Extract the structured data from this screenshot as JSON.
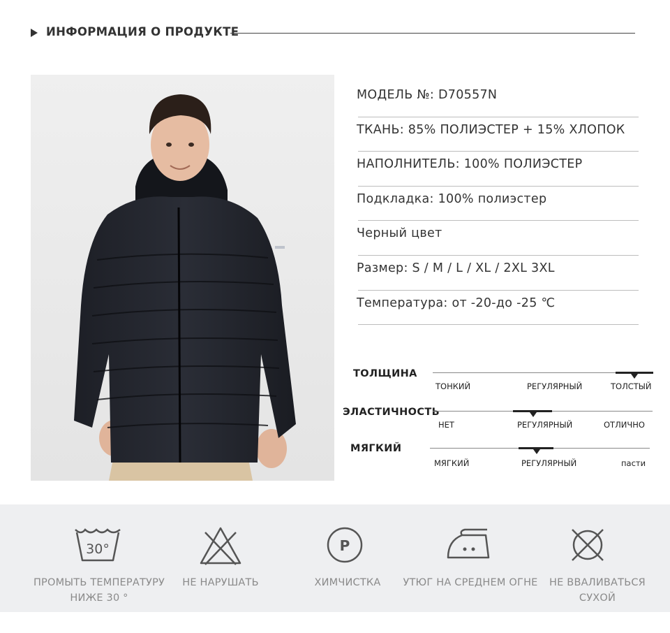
{
  "header": {
    "title": "ИНФОРМАЦИЯ О ПРОДУКТЕ"
  },
  "specs": [
    "МОДЕЛЬ №: D70557N",
    "ТКАНЬ: 85% ПОЛИЭСТЕР + 15% ХЛОПОК",
    "НАПОЛНИТЕЛЬ: 100% ПОЛИЭСТЕР",
    "Подкладка: 100% полиэстер",
    "Черный цвет",
    "Размер: S / M / L / XL / 2XL 3XL",
    "Температура: от -20-до -25 ℃"
  ],
  "scales": [
    {
      "label": "ТОЛЩИНА",
      "options": [
        "ТОНКИЙ",
        "РЕГУЛЯРНЫЙ",
        "ТОЛСТЫЙ"
      ],
      "selected": "ТОЛСТЫЙ"
    },
    {
      "label": "ЭЛАСТИЧНОСТЬ",
      "options": [
        "НЕТ",
        "РЕГУЛЯРНЫЙ",
        "ОТЛИЧНО"
      ],
      "selected": "РЕГУЛЯРНЫЙ"
    },
    {
      "label": "МЯГКИЙ",
      "options": [
        "МЯГКИЙ",
        "РЕГУЛЯРНЫЙ",
        "пасти"
      ],
      "selected": "РЕГУЛЯРНЫЙ"
    }
  ],
  "care": [
    {
      "icon": "wash-30-icon",
      "wash_temp": "30°",
      "label_1": "ПРОМЫТЬ ТЕМПЕРАТУРУ",
      "label_2": "НИЖЕ 30 °"
    },
    {
      "icon": "do-not-bleach-icon",
      "label_1": "НЕ НАРУШАТЬ",
      "label_2": ""
    },
    {
      "icon": "dry-clean-p-icon",
      "letter": "P",
      "label_1": "ХИМЧИСТКА",
      "label_2": ""
    },
    {
      "icon": "iron-medium-icon",
      "label_1": "УТЮГ НА СРЕДНЕМ ОГНЕ",
      "label_2": ""
    },
    {
      "icon": "do-not-tumble-dry-icon",
      "label_1": "НЕ ВВАЛИВАТЬСЯ",
      "label_2": "СУХОЙ"
    }
  ]
}
